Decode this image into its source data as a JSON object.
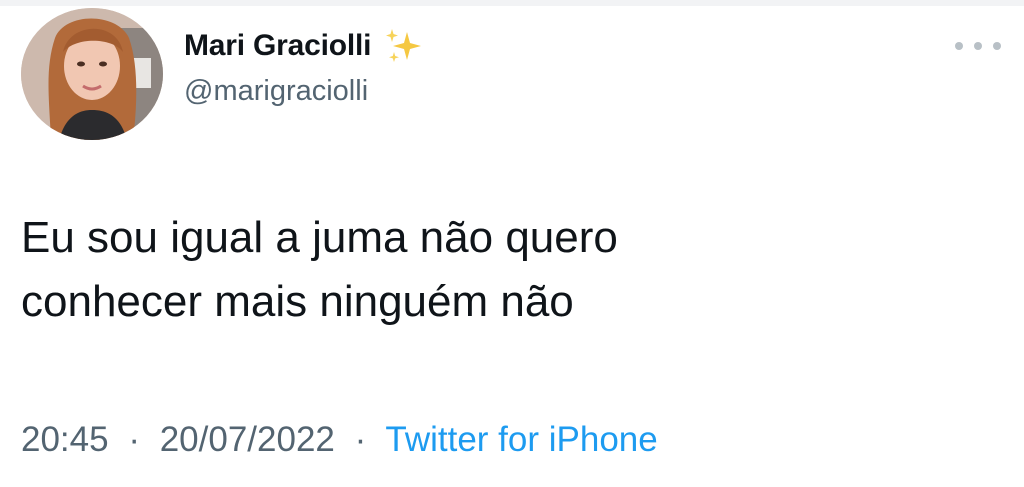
{
  "author": {
    "display_name": "Mari Graciolli",
    "handle": "@marigraciolli",
    "badge_icon": "sparkles-icon"
  },
  "tweet": {
    "text": "Eu sou igual a juma não quero\nconhecer mais ninguém não",
    "time": "20:45",
    "date": "20/07/2022",
    "separator": "·",
    "source": "Twitter for iPhone"
  },
  "menu": {
    "icon": "more-horizontal-icon"
  },
  "colors": {
    "text": "#0f1419",
    "secondary": "#536471",
    "link": "#1d9bf0",
    "menu_dots": "#b8c0c6"
  }
}
